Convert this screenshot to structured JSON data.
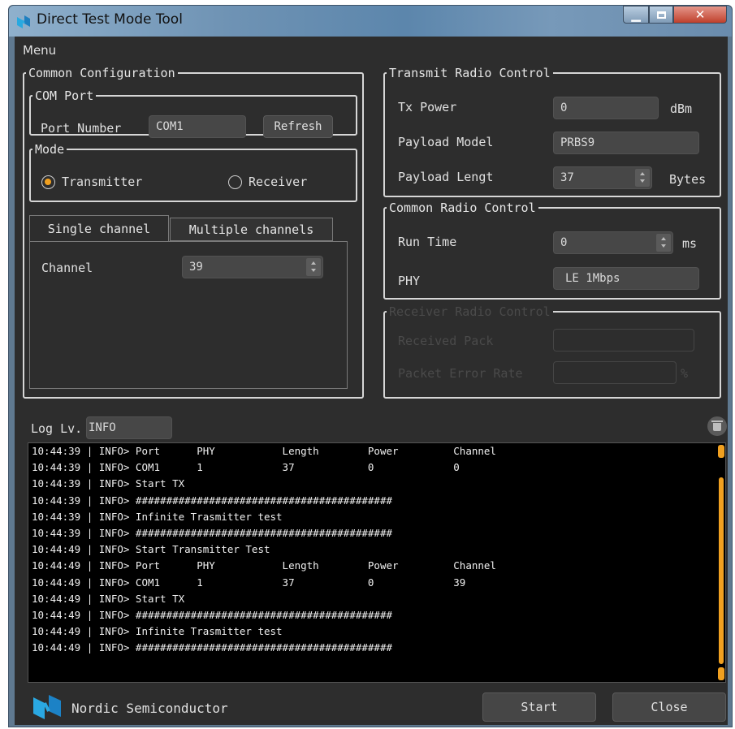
{
  "window": {
    "title": "Direct Test Mode Tool"
  },
  "menu": {
    "label": "Menu"
  },
  "common_config": {
    "legend": "Common Configuration",
    "com_port": {
      "legend": "COM Port",
      "port_label": "Port Number",
      "port_value": "COM1",
      "refresh_label": "Refresh"
    },
    "mode": {
      "legend": "Mode",
      "transmitter": "Transmitter",
      "receiver": "Receiver",
      "selected": "Transmitter"
    },
    "tabs": [
      {
        "label": "Single channel",
        "active": true
      },
      {
        "label": "Multiple channels",
        "active": false
      }
    ],
    "channel_label": "Channel",
    "channel_value": "39"
  },
  "transmit": {
    "legend": "Transmit Radio Control",
    "tx_power_label": "Tx Power",
    "tx_power_value": "0",
    "tx_power_unit": "dBm",
    "payload_model_label": "Payload Model",
    "payload_model_value": "PRBS9",
    "payload_length_label": "Payload Lengt",
    "payload_length_value": "37",
    "payload_length_unit": "Bytes"
  },
  "common_radio": {
    "legend": "Common Radio Control",
    "run_time_label": "Run Time",
    "run_time_value": "0",
    "run_time_unit": "ms",
    "phy_label": "PHY",
    "phy_value": "LE 1Mbps"
  },
  "receiver": {
    "legend": "Receiver Radio Control",
    "received_label": "Received Pack",
    "per_label": "Packet Error Rate",
    "per_unit": "%"
  },
  "log": {
    "level_label": "Log Lv.",
    "level_value": "INFO",
    "lines": [
      "10:44:39 | INFO> Port      PHY           Length        Power         Channel",
      "10:44:39 | INFO> COM1      1             37            0             0",
      "10:44:39 | INFO> Start TX",
      "10:44:39 | INFO> ##########################################",
      "10:44:39 | INFO> Infinite Trasmitter test",
      "10:44:39 | INFO> ##########################################",
      "10:44:49 | INFO> Start Transmitter Test",
      "10:44:49 | INFO> Port      PHY           Length        Power         Channel",
      "10:44:49 | INFO> COM1      1             37            0             39",
      "10:44:49 | INFO> Start TX",
      "10:44:49 | INFO> ##########################################",
      "10:44:49 | INFO> Infinite Trasmitter test",
      "10:44:49 | INFO> ##########################################"
    ]
  },
  "footer": {
    "brand": "Nordic Semiconductor",
    "start_label": "Start",
    "close_label": "Close"
  },
  "colors": {
    "accent": "#f0a020",
    "background": "#2d2d2d",
    "field": "#474747"
  },
  "icons": {
    "app": "nordic-logo-icon",
    "trash": "trash-icon"
  }
}
